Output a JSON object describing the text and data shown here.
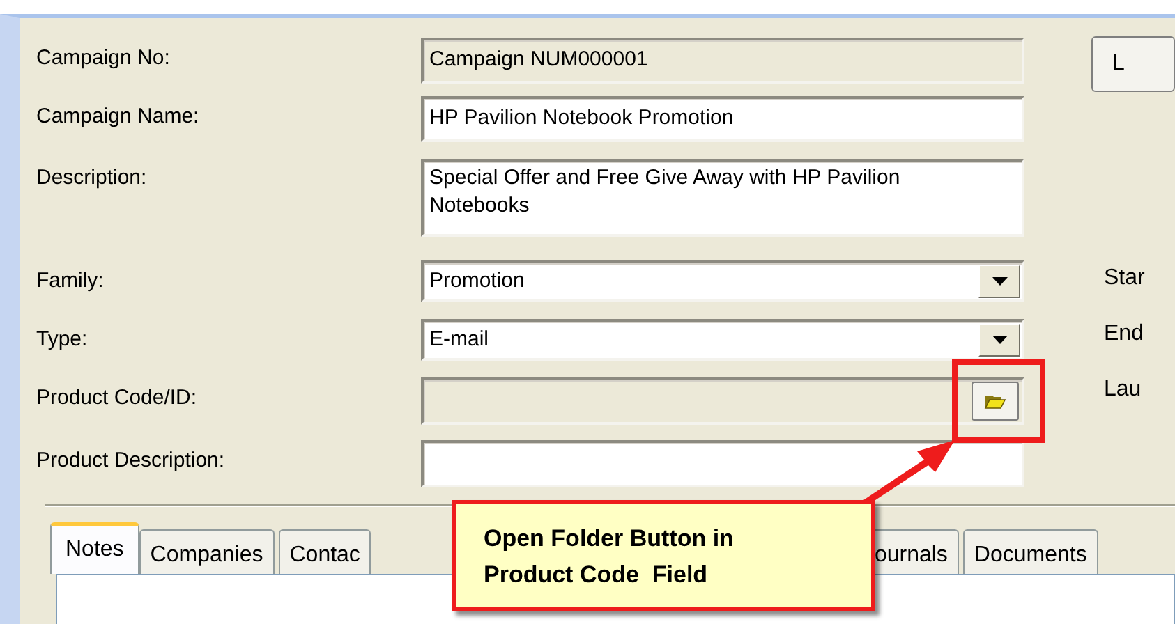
{
  "fields": [
    {
      "label": "Campaign No:",
      "kind": "readonly",
      "value": "Campaign NUM000001"
    },
    {
      "label": "Campaign Name:",
      "kind": "text",
      "value": "HP Pavilion Notebook Promotion"
    },
    {
      "label": "Description:",
      "kind": "multiline",
      "value": "Special Offer and Free Give Away with HP Pavilion Notebooks"
    },
    {
      "label": "Family:",
      "kind": "dropdown",
      "value": "Promotion"
    },
    {
      "label": "Type:",
      "kind": "dropdown",
      "value": "E-mail"
    },
    {
      "label": "Product Code/ID:",
      "kind": "lookup"
    },
    {
      "label": "Product Description:",
      "kind": "text"
    }
  ],
  "right_button": {
    "label": "L"
  },
  "right_labels": [
    "Star",
    "End",
    "Lau"
  ],
  "tabs": [
    {
      "label": "Notes",
      "selected": true
    },
    {
      "label": "Companies",
      "selected": false
    },
    {
      "label": "Contac",
      "selected": false
    },
    {
      "label": "ournals",
      "selected": false
    },
    {
      "label": "Documents",
      "selected": false
    }
  ],
  "callout": {
    "lines": [
      "Open Folder Button in",
      "Product Code  Field"
    ]
  }
}
